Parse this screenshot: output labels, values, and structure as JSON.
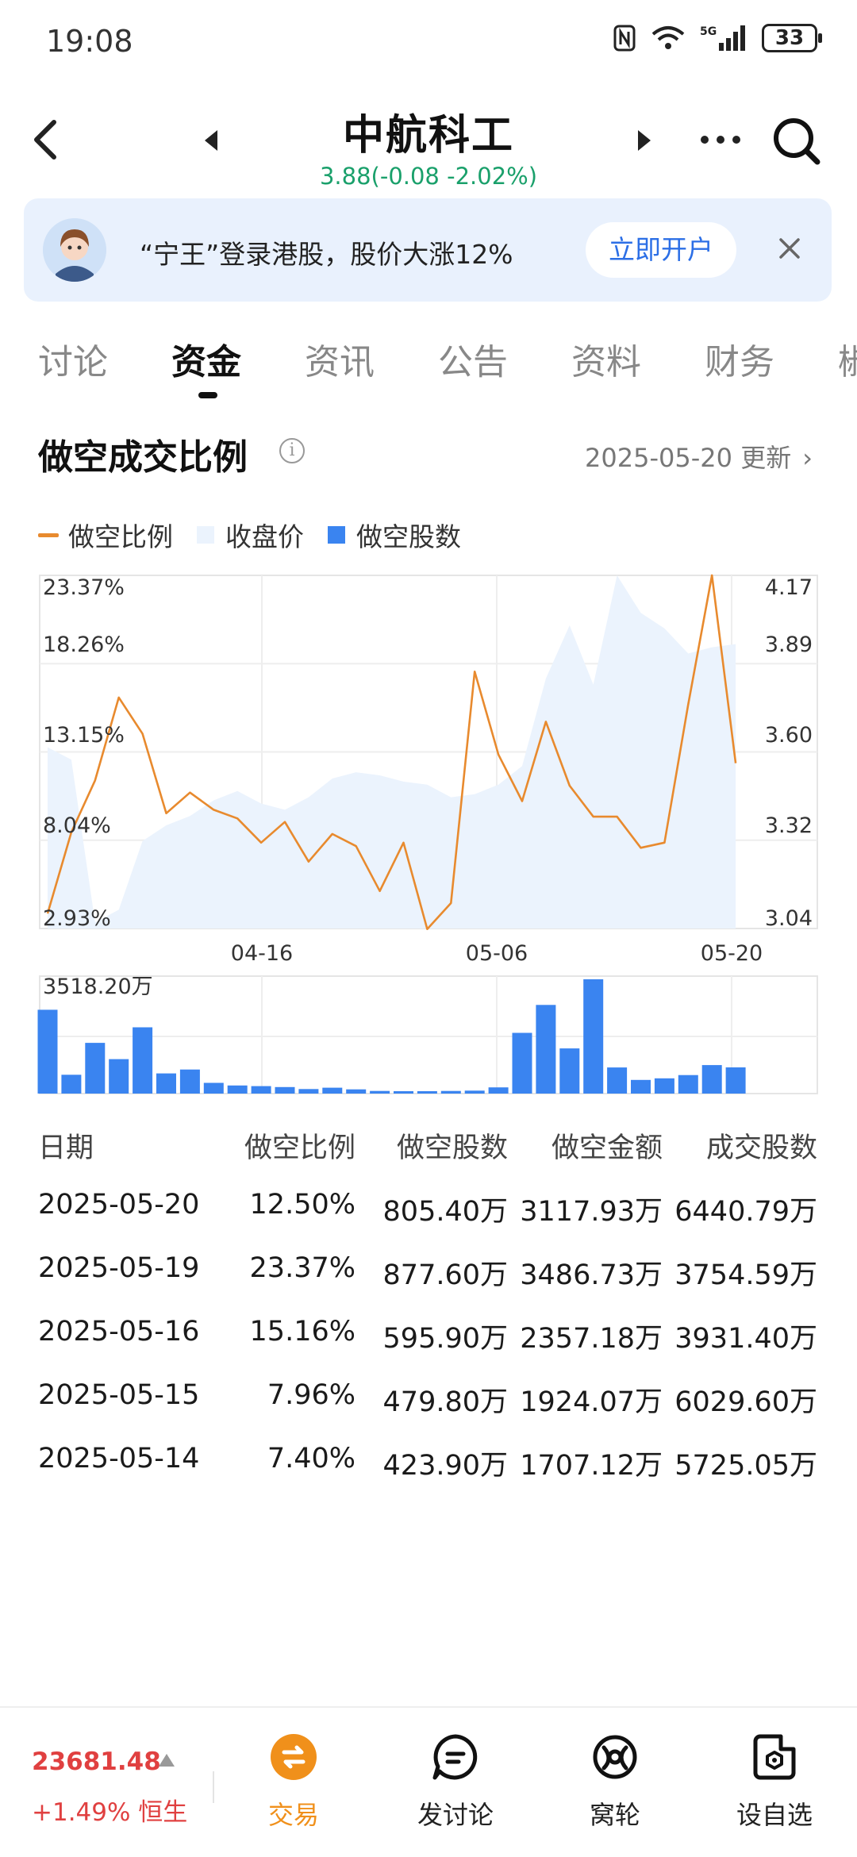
{
  "status_bar": {
    "time": "19:08",
    "battery": "33",
    "network": "5G"
  },
  "header": {
    "title": "中航科工",
    "subtitle": "3.88(-0.08 -2.02%)"
  },
  "banner": {
    "text": "“宁王”登录港股，股价大涨12%",
    "button": "立即开户"
  },
  "tabs": [
    "讨论",
    "资金",
    "资讯",
    "公告",
    "资料",
    "财务",
    "椒"
  ],
  "active_tab": 1,
  "section": {
    "title": "做空成交比例",
    "update": "2025-05-20 更新"
  },
  "legend": {
    "line": "做空比例",
    "area": "收盘价",
    "bar": "做空股数"
  },
  "colors": {
    "line": "#e88a2e",
    "area": "#ebf3fd",
    "bar": "#3a84f0",
    "up": "#e04040",
    "down": "#1aa06b",
    "accent": "#f0901b"
  },
  "chart_data": [
    {
      "type": "line",
      "series": [
        {
          "name": "做空比例",
          "unit": "%",
          "values": [
            3.8,
            8.5,
            11.5,
            16.3,
            14.2,
            9.6,
            10.8,
            9.8,
            9.3,
            7.9,
            9.1,
            6.8,
            8.4,
            7.7,
            5.1,
            7.9,
            2.9,
            4.4,
            17.8,
            13.0,
            10.3,
            14.9,
            11.2,
            9.4,
            9.4,
            7.6,
            7.9,
            15.9,
            23.37,
            12.5
          ]
        },
        {
          "name": "收盘价",
          "type": "area",
          "values": [
            3.62,
            3.58,
            3.06,
            3.1,
            3.32,
            3.37,
            3.4,
            3.45,
            3.48,
            3.44,
            3.42,
            3.46,
            3.52,
            3.54,
            3.53,
            3.51,
            3.5,
            3.46,
            3.47,
            3.5,
            3.56,
            3.84,
            4.01,
            3.82,
            4.17,
            4.05,
            4.0,
            3.92,
            3.94,
            3.95
          ]
        }
      ],
      "x_ticks": [
        "04-16",
        "05-06",
        "05-20"
      ],
      "y_left_ticks": [
        "23.37%",
        "18.26%",
        "13.15%",
        "8.04%",
        "2.93%"
      ],
      "y_right_ticks": [
        "4.17",
        "3.89",
        "3.60",
        "3.32",
        "3.04"
      ],
      "ylim_left": [
        2.93,
        23.37
      ],
      "ylim_right": [
        3.04,
        4.17
      ],
      "grid": true
    },
    {
      "type": "bar",
      "series": [
        {
          "name": "做空股数",
          "unit": "万",
          "values": [
            2580,
            580,
            1560,
            1060,
            2040,
            620,
            740,
            330,
            250,
            230,
            200,
            140,
            180,
            130,
            80,
            60,
            40,
            80,
            90,
            190,
            1870,
            2730,
            1390,
            3518.2,
            805,
            420,
            470,
            570,
            877.6,
            805.4
          ]
        }
      ],
      "y_max_label": "3518.20万",
      "ylim": [
        0,
        3518.2
      ]
    }
  ],
  "table": {
    "headers": [
      "日期",
      "做空比例",
      "做空股数",
      "做空金额",
      "成交股数"
    ],
    "rows": [
      [
        "2025-05-20",
        "12.50%",
        "805.40万",
        "3117.93万",
        "6440.79万"
      ],
      [
        "2025-05-19",
        "23.37%",
        "877.60万",
        "3486.73万",
        "3754.59万"
      ],
      [
        "2025-05-16",
        "15.16%",
        "595.90万",
        "2357.18万",
        "3931.40万"
      ],
      [
        "2025-05-15",
        "7.96%",
        "479.80万",
        "1924.07万",
        "6029.60万"
      ],
      [
        "2025-05-14",
        "7.40%",
        "423.90万",
        "1707.12万",
        "5725.05万"
      ]
    ]
  },
  "bottom": {
    "index_value": "23681.48",
    "index_change": "+1.49% 恒生",
    "nav": [
      {
        "label": "交易",
        "icon": "trade-icon",
        "active": true
      },
      {
        "label": "发讨论",
        "icon": "post-discussion-icon"
      },
      {
        "label": "窝轮",
        "icon": "warrant-icon"
      },
      {
        "label": "设自选",
        "icon": "add-watchlist-icon"
      }
    ]
  }
}
